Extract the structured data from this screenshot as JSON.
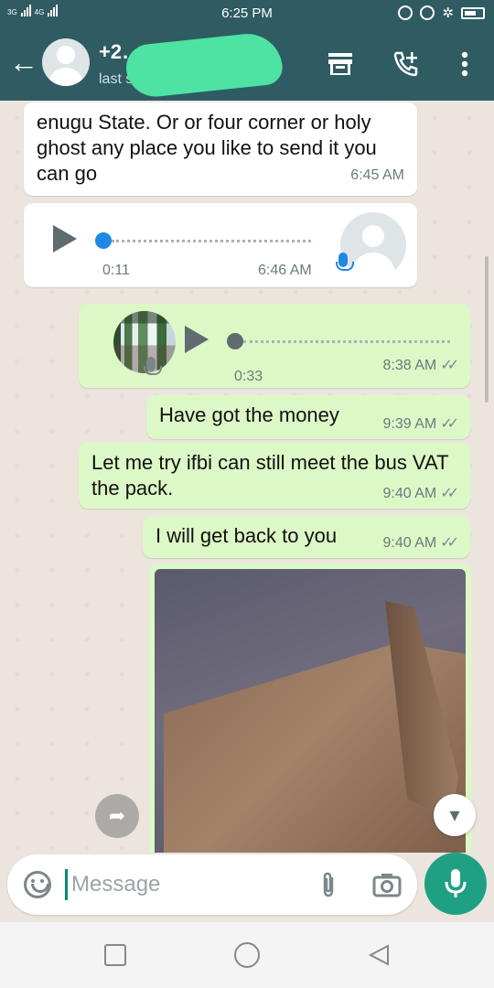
{
  "status_bar": {
    "network_1": "3G",
    "network_2": "4G",
    "time": "6:25 PM"
  },
  "header": {
    "contact_name": "+2………………5",
    "last_seen": "last seen today at 7:56 PM",
    "icons": [
      "back-arrow-icon",
      "avatar",
      "store-icon",
      "add-call-icon",
      "more-vert-icon"
    ]
  },
  "messages": [
    {
      "type": "text",
      "direction": "in",
      "text": "enugu State. Or or four corner or holy ghost any place you like to send it you can go",
      "time": "6:45 AM"
    },
    {
      "type": "voice",
      "direction": "in",
      "duration": "0:11",
      "time": "6:46 AM",
      "progress": 0
    },
    {
      "type": "voice",
      "direction": "out",
      "duration": "0:33",
      "time": "8:38 AM",
      "progress": 0,
      "ticks": "✓✓"
    },
    {
      "type": "text",
      "direction": "out",
      "text": "Have got  the money",
      "time": "9:39 AM",
      "ticks": "✓✓"
    },
    {
      "type": "text",
      "direction": "out",
      "text": "Let me  try ifbi can still  meet the bus VAT the pack.",
      "time": "9:40 AM",
      "ticks": "✓✓"
    },
    {
      "type": "text",
      "direction": "out",
      "text": "I will  get back to you",
      "time": "9:40 AM",
      "ticks": "✓✓"
    },
    {
      "type": "image",
      "direction": "out"
    }
  ],
  "composer": {
    "placeholder": "Message",
    "value": ""
  },
  "colors": {
    "header": "#2f5b63",
    "outgoing_bubble": "#dcf8c6",
    "incoming_bubble": "#ffffff",
    "voice_in_accent": "#1e88e5",
    "fab": "#1fa082"
  }
}
